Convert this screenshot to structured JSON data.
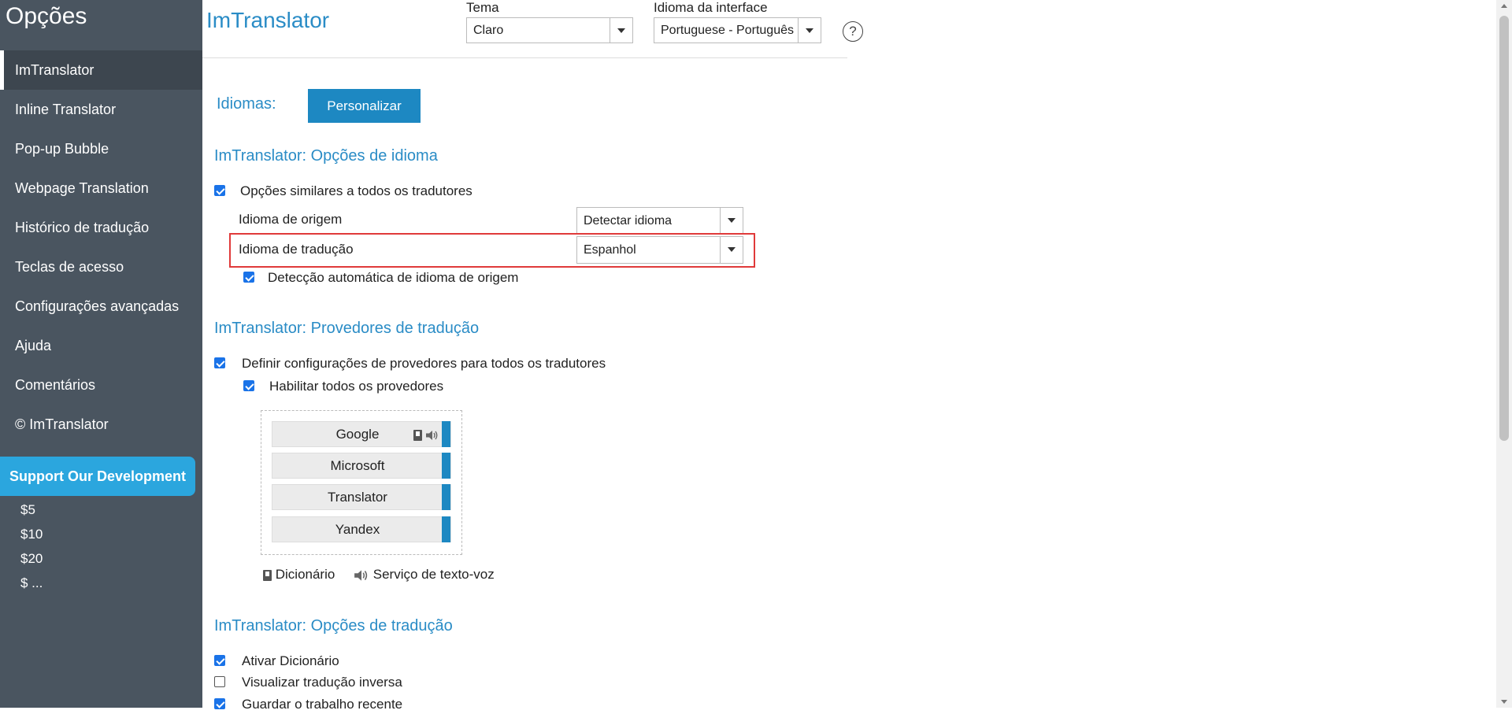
{
  "sidebar": {
    "title": "Opções",
    "items": [
      {
        "label": "ImTranslator",
        "active": true
      },
      {
        "label": "Inline Translator"
      },
      {
        "label": "Pop-up Bubble"
      },
      {
        "label": "Webpage Translation"
      },
      {
        "label": "Histórico de tradução"
      },
      {
        "label": "Teclas de acesso"
      },
      {
        "label": "Configurações avançadas"
      },
      {
        "label": "Ajuda"
      },
      {
        "label": "Comentários"
      },
      {
        "label": "© ImTranslator"
      }
    ],
    "support_label": "Support Our Development",
    "donations": [
      "$5",
      "$10",
      "$20",
      "$ ..."
    ]
  },
  "header": {
    "app_title": "ImTranslator",
    "theme_label": "Tema",
    "theme_value": "Claro",
    "ui_lang_label": "Idioma da interface",
    "ui_lang_value": "Portuguese - Português",
    "help_symbol": "?"
  },
  "languages": {
    "label": "Idiomas:",
    "customize_button": "Personalizar"
  },
  "lang_options": {
    "title": "ImTranslator: Opções de idioma",
    "same_for_all": {
      "label": "Opções similares a todos os tradutores",
      "checked": true
    },
    "source_label": "Idioma de origem",
    "source_value": "Detectar idioma",
    "target_label": "Idioma de tradução",
    "target_value": "Espanhol",
    "autodetect": {
      "label": "Detecção automática de idioma de origem",
      "checked": true
    }
  },
  "providers": {
    "title": "ImTranslator: Provedores de tradução",
    "define_all": {
      "label": "Definir configurações de provedores para todos os tradutores",
      "checked": true
    },
    "enable_all": {
      "label": "Habilitar todos os provedores",
      "checked": true
    },
    "list": [
      "Google",
      "Microsoft",
      "Translator",
      "Yandex"
    ],
    "legend_dictionary": "Dicionário",
    "legend_tts": "Serviço de texto-voz"
  },
  "translation_options": {
    "title": "ImTranslator: Opções de tradução",
    "items": [
      {
        "label": "Ativar Dicionário",
        "checked": true
      },
      {
        "label": "Visualizar tradução inversa",
        "checked": false
      },
      {
        "label": "Guardar o trabalho recente",
        "checked": true
      }
    ]
  }
}
